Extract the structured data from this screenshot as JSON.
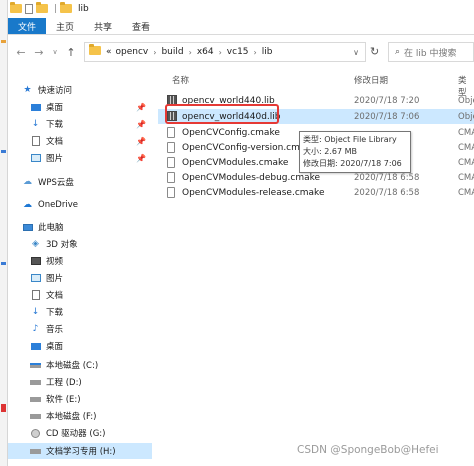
{
  "window": {
    "title": "lib",
    "title_separator": "|"
  },
  "ribbon": {
    "tabs": [
      "文件",
      "主页",
      "共享",
      "查看"
    ],
    "active_tab": "文件"
  },
  "address": {
    "prefix": "«",
    "crumbs": [
      "opencv",
      "build",
      "x64",
      "vc15",
      "lib"
    ],
    "search_placeholder": "在 lib 中搜索"
  },
  "nav": {
    "quick_access": "快速访问",
    "items": [
      {
        "label": "桌面",
        "icon": "desktop-icon",
        "pinned": true
      },
      {
        "label": "下载",
        "icon": "download-icon",
        "pinned": true
      },
      {
        "label": "文档",
        "icon": "document-icon",
        "pinned": true
      },
      {
        "label": "图片",
        "icon": "picture-icon",
        "pinned": true
      }
    ],
    "wps": "WPS云盘",
    "onedrive": "OneDrive",
    "this_pc": "此电脑",
    "pc_items": [
      {
        "label": "3D 对象",
        "icon": "3d-objects-icon"
      },
      {
        "label": "视频",
        "icon": "video-icon"
      },
      {
        "label": "图片",
        "icon": "picture-icon"
      },
      {
        "label": "文档",
        "icon": "document-icon"
      },
      {
        "label": "下载",
        "icon": "download-icon"
      },
      {
        "label": "音乐",
        "icon": "music-icon"
      },
      {
        "label": "桌面",
        "icon": "desktop-icon"
      },
      {
        "label": "本地磁盘 (C:)",
        "icon": "drive-icon"
      },
      {
        "label": "工程 (D:)",
        "icon": "drive-icon"
      },
      {
        "label": "软件 (E:)",
        "icon": "drive-icon"
      },
      {
        "label": "本地磁盘 (F:)",
        "icon": "drive-icon"
      },
      {
        "label": "CD 驱动器 (G:)",
        "icon": "cd-drive-icon"
      },
      {
        "label": "文档学习专用 (H:)",
        "icon": "drive-icon"
      }
    ]
  },
  "columns": {
    "name": "名称",
    "date": "修改日期",
    "type": "类型"
  },
  "files": [
    {
      "name": "opencv_world440.lib",
      "date": "2020/7/18 7:20",
      "type": "Objec",
      "icon": "lib-file-icon"
    },
    {
      "name": "opencv_world440d.lib",
      "date": "2020/7/18 7:06",
      "type": "Objec",
      "icon": "lib-file-icon"
    },
    {
      "name": "OpenCVConfig.cmake",
      "date": "",
      "type": "CMAK",
      "icon": "cmake-file-icon"
    },
    {
      "name": "OpenCVConfig-version.cma",
      "date": "",
      "type": "CMAK",
      "icon": "cmake-file-icon"
    },
    {
      "name": "OpenCVModules.cmake",
      "date": "",
      "type": "CMAK",
      "icon": "cmake-file-icon"
    },
    {
      "name": "OpenCVModules-debug.cmake",
      "date": "2020/7/18 6:58",
      "type": "CMAK",
      "icon": "cmake-file-icon"
    },
    {
      "name": "OpenCVModules-release.cmake",
      "date": "2020/7/18 6:58",
      "type": "CMAK",
      "icon": "cmake-file-icon"
    }
  ],
  "tooltip": {
    "type_line": "类型: Object File Library",
    "size_line": "大小: 2.67 MB",
    "date_line": "修改日期: 2020/7/18 7:06"
  },
  "watermark": "CSDN @SpongeBob@Hefei",
  "colors": {
    "accent": "#1979ca",
    "selection": "#cce8ff",
    "highlight_box": "#e53935"
  }
}
